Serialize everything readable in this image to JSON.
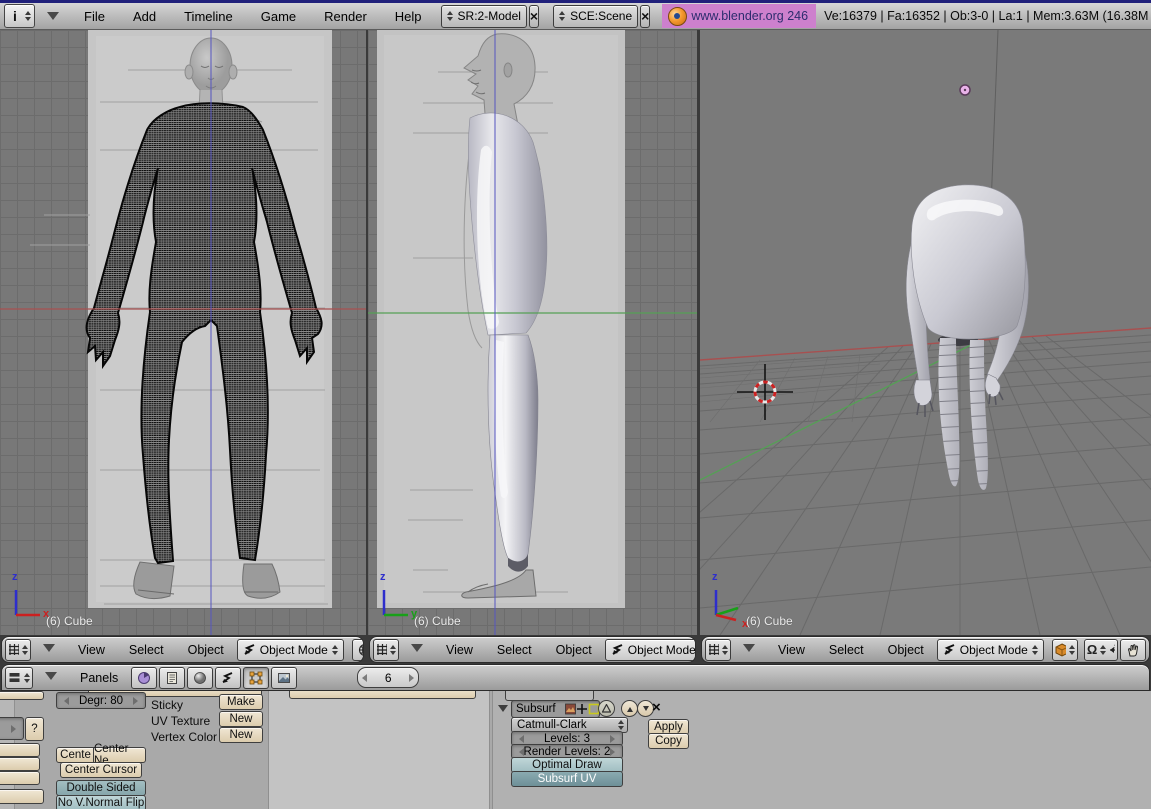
{
  "header": {
    "menus": [
      "File",
      "Add",
      "Timeline",
      "Game",
      "Render",
      "Help"
    ],
    "screen_selector": "SR:2-Model",
    "scene_selector": "SCE:Scene",
    "blender_link": "www.blender.org 246",
    "stats": "Ve:16379 | Fa:16352 | Ob:3-0 | La:1  | Mem:3.63M (16.38M"
  },
  "viewport_header": {
    "menus": [
      "View",
      "Select",
      "Object"
    ],
    "mode": "Object Mode"
  },
  "viewports": {
    "object_label": "(6) Cube",
    "axis_z": "z",
    "axis_x": "x",
    "axis_y": "y"
  },
  "buttons_header": {
    "panels_label": "Panels",
    "frame": "6"
  },
  "mesh_panel": {
    "degr": "Degr: 80",
    "sticky_label": "Sticky",
    "make_button": "Make",
    "uv_texture_label": "UV Texture",
    "uv_new_button": "New",
    "vertex_color_label": "Vertex Color",
    "vertex_new_button": "New",
    "center_button": "Cente",
    "center_new_button": "Center Ne",
    "center_cursor_button": "Center Cursor",
    "double_sided_toggle": "Double Sided",
    "no_vnormal_flip_toggle": "No V.Normal Flip",
    "help_button": "?"
  },
  "modifier_panel": {
    "name": "Subsurf",
    "type_dropdown": "Catmull-Clark",
    "levels_slider": "Levels: 3",
    "render_levels_slider": "Render Levels: 2",
    "optimal_draw_toggle": "Optimal Draw",
    "subsurf_uv_toggle": "Subsurf UV",
    "apply_button": "Apply",
    "copy_button": "Copy"
  },
  "icons": {
    "close": "×",
    "info": "i",
    "pivot_omega": "Ω"
  },
  "colors": {
    "header_gray": "#b6b6b6",
    "viewport_gray": "#787878",
    "button_beige": "#e6dcc4",
    "toggle_teal_light": "#aec9cc",
    "toggle_teal_dark": "#7fa2a8",
    "badge_purple": "#cd80cd",
    "axis_red": "#a85050",
    "axis_green": "#55a055",
    "axis_blue": "#5858c0",
    "wire_black": "#101010"
  }
}
